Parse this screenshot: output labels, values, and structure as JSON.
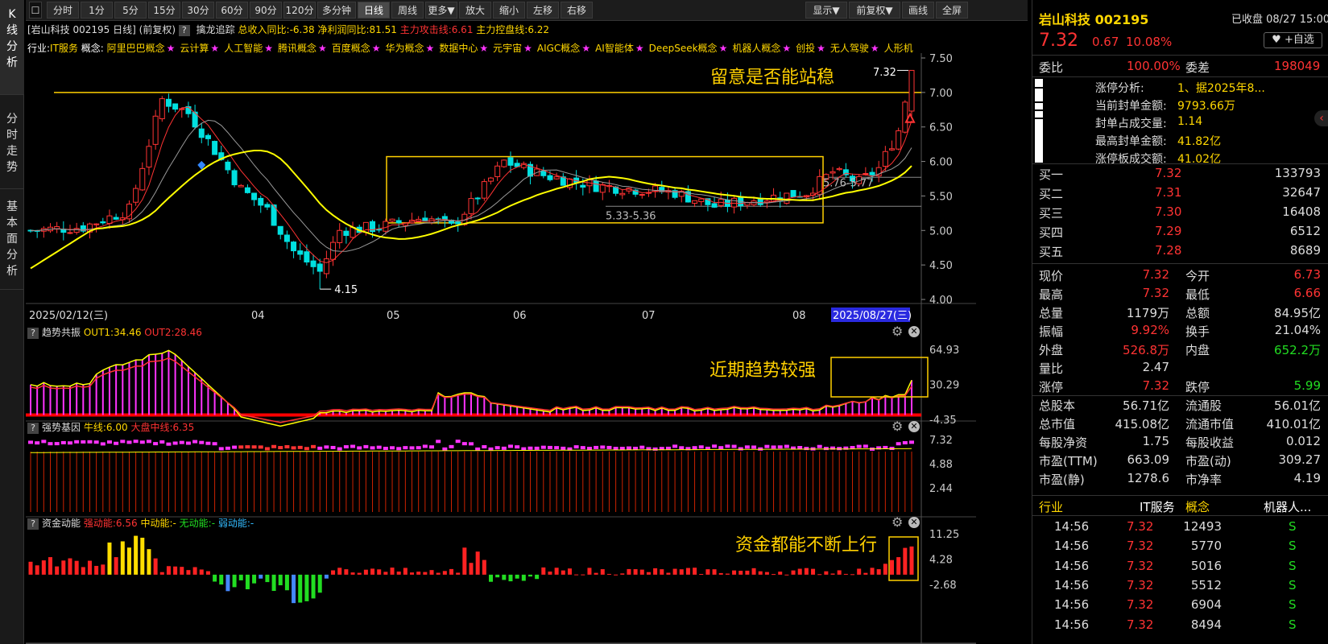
{
  "left_tabs": [
    "K线分析",
    "分时走势",
    "基本面分析"
  ],
  "toolbar": {
    "left": [
      "分时",
      "1分",
      "5分",
      "15分",
      "30分",
      "60分",
      "90分",
      "120分",
      "多分钟",
      "日线",
      "周线",
      "更多▼",
      "放大",
      "缩小",
      "左移",
      "右移"
    ],
    "right": [
      "显示▼",
      "前复权▼",
      "画线",
      "全屏"
    ],
    "active": "日线"
  },
  "info": {
    "title": "[岩山科技 002195 日线]",
    "mode": "(前复权)",
    "indicator": "擒龙追踪",
    "rev_label": "总收入同比:",
    "rev_val": "-6.38",
    "np_label": "净利润同比:",
    "np_val": "81.51",
    "atk_label": "主力攻击线:",
    "atk_val": "6.61",
    "ctl_label": "主力控盘线:",
    "ctl_val": "6.22"
  },
  "concepts": {
    "industry_label": "行业:",
    "industry": "IT服务",
    "concept_label": "概念:",
    "items": [
      "阿里巴巴概念",
      "云计算",
      "人工智能",
      "腾讯概念",
      "百度概念",
      "华为概念",
      "数据中心",
      "元宇宙",
      "AIGC概念",
      "AI智能体",
      "DeepSeek概念",
      "机器人概念",
      "创投",
      "无人驾驶",
      "人形机"
    ],
    "star": "★"
  },
  "main_chart": {
    "y_ticks": [
      "7.50",
      "7.00",
      "6.50",
      "6.00",
      "5.50",
      "5.00",
      "4.50",
      "4.00"
    ],
    "x_ticks": [
      "2025/02/12(三)",
      "04",
      "05",
      "06",
      "07",
      "08"
    ],
    "current_date": "2025/08/27(三)",
    "level_line": "7.00",
    "box_high": "6.07",
    "box_low": "5.11",
    "marks": {
      "high": "7.32",
      "low": "4.15",
      "range1": "5.33-5.36",
      "range2": "5.76-5.77"
    },
    "annotation": "留意是否能站稳"
  },
  "panel1": {
    "name": "趋势共振",
    "l1": "OUT1:",
    "v1": "34.46",
    "l2": "OUT2:",
    "v2": "28.46",
    "ticks": [
      "64.93",
      "30.29",
      "-4.35"
    ],
    "annotation": "近期趋势较强"
  },
  "panel2": {
    "name": "强势基因",
    "l1": "牛线:",
    "v1": "6.00",
    "l2": "大盘中线:",
    "v2": "6.35",
    "ticks": [
      "7.32",
      "4.88",
      "2.44"
    ]
  },
  "panel3": {
    "name": "资金动能",
    "l1": "强动能:",
    "v1": "6.56",
    "l2": "中动能:",
    "v2": "-",
    "l3": "无动能:",
    "v3": "-",
    "l4": "弱动能:",
    "v4": "-",
    "ticks": [
      "11.25",
      "4.28",
      "-2.68"
    ],
    "annotation": "资金都能不断上行"
  },
  "quote": {
    "name": "岩山科技 002195",
    "status": "已收盘 08/27 15:00",
    "price": "7.32",
    "change": "0.67",
    "pct": "10.08%",
    "fav": "+自选",
    "wb_label": "委比",
    "wb": "100.00%",
    "wc_label": "委差",
    "wc": "198049",
    "lu": [
      [
        "涨停分析:",
        "1、据2025年8..."
      ],
      [
        "当前封单金额:",
        "9793.66万"
      ],
      [
        "封单占成交量:",
        "1.14"
      ],
      [
        "最高封单金额:",
        "41.82亿"
      ],
      [
        "涨停板成交额:",
        "41.02亿"
      ]
    ],
    "bids": [
      [
        "买一",
        "7.32",
        "133793"
      ],
      [
        "买二",
        "7.31",
        "32647"
      ],
      [
        "买三",
        "7.30",
        "16408"
      ],
      [
        "买四",
        "7.29",
        "6512"
      ],
      [
        "买五",
        "7.28",
        "8689"
      ]
    ],
    "stats": [
      [
        "现价",
        "7.32",
        "今开",
        "6.73"
      ],
      [
        "最高",
        "7.32",
        "最低",
        "6.66"
      ],
      [
        "总量",
        "1179万",
        "总额",
        "84.95亿"
      ],
      [
        "振幅",
        "9.92%",
        "换手",
        "21.04%"
      ],
      [
        "外盘",
        "526.8万",
        "内盘",
        "652.2万"
      ],
      [
        "量比",
        "2.47",
        "",
        ""
      ],
      [
        "涨停",
        "7.32",
        "跌停",
        "5.99"
      ],
      [
        "总股本",
        "56.71亿",
        "流通股",
        "56.01亿"
      ],
      [
        "总市值",
        "415.08亿",
        "流通市值",
        "410.01亿"
      ],
      [
        "每股净资",
        "1.75",
        "每股收益",
        "0.012"
      ],
      [
        "市盈(TTM)",
        "663.09",
        "市盈(动)",
        "309.27"
      ],
      [
        "市盈(静)",
        "1278.6",
        "市净率",
        "4.19"
      ]
    ],
    "ind": {
      "l1": "行业",
      "v1": "IT服务",
      "l2": "概念",
      "v2": "机器人..."
    },
    "ticks": [
      [
        "14:56",
        "7.32",
        "12493",
        "S"
      ],
      [
        "14:56",
        "7.32",
        "5770",
        "S"
      ],
      [
        "14:56",
        "7.32",
        "5016",
        "S"
      ],
      [
        "14:56",
        "7.32",
        "5512",
        "S"
      ],
      [
        "14:56",
        "7.32",
        "6904",
        "S"
      ],
      [
        "14:56",
        "7.32",
        "8494",
        "S"
      ]
    ]
  },
  "colors": {
    "up": "#ff3333",
    "down": "#00e0e0",
    "ma": "#ffff00",
    "box": "#ffd000"
  }
}
